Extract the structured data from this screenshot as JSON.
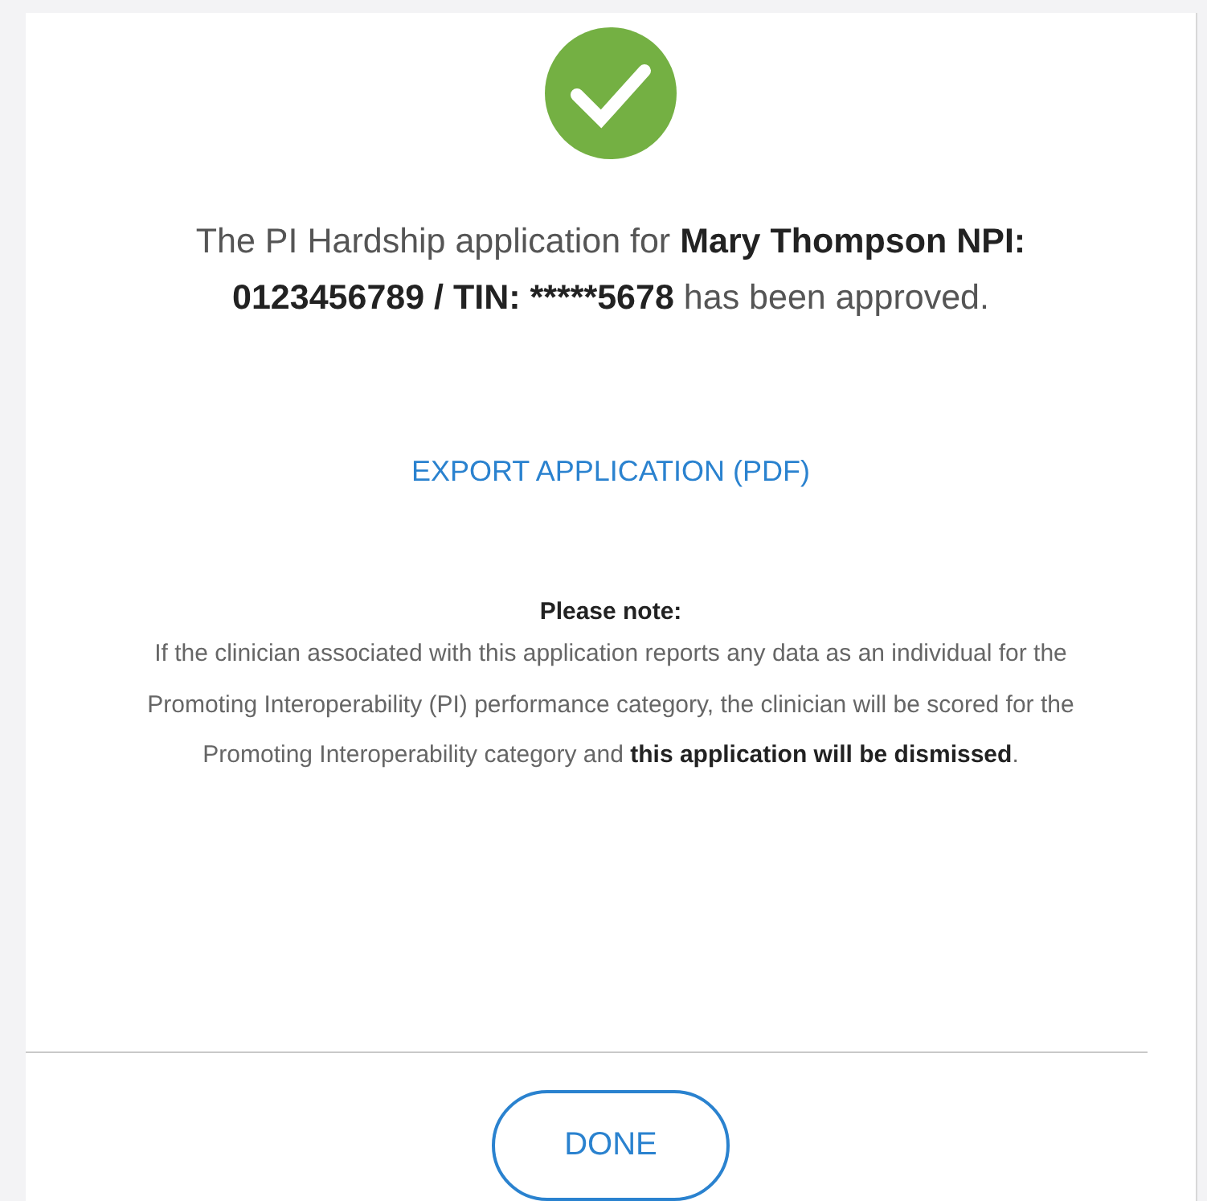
{
  "dialog": {
    "message": [
      {
        "text": "The PI Hardship application for ",
        "bold": false
      },
      {
        "text": "Mary Thompson NPI: 0123456789 / TIN: *****5678",
        "bold": true
      },
      {
        "text": " has been approved.",
        "bold": false
      }
    ],
    "export_link": "EXPORT APPLICATION (PDF)",
    "note_title": "Please note:",
    "note_text": "If the clinician associated with this application reports any data as an individual for the Promoting Interoperability (PI) performance category, the clinician will be scored for the Promoting Interoperability category and **this application will be dismissed**.",
    "buttons": [
      "DONE"
    ]
  }
}
